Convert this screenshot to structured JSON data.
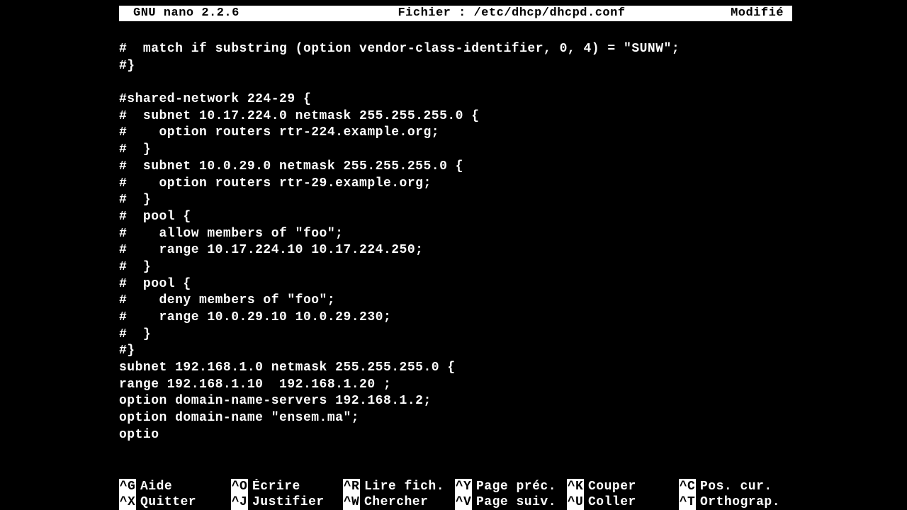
{
  "titlebar": {
    "app": "GNU nano 2.2.6",
    "file_label": "Fichier : /etc/dhcp/dhcpd.conf",
    "status": "Modifié"
  },
  "lines": [
    "#  match if substring (option vendor-class-identifier, 0, 4) = \"SUNW\";",
    "#}",
    "",
    "#shared-network 224-29 {",
    "#  subnet 10.17.224.0 netmask 255.255.255.0 {",
    "#    option routers rtr-224.example.org;",
    "#  }",
    "#  subnet 10.0.29.0 netmask 255.255.255.0 {",
    "#    option routers rtr-29.example.org;",
    "#  }",
    "#  pool {",
    "#    allow members of \"foo\";",
    "#    range 10.17.224.10 10.17.224.250;",
    "#  }",
    "#  pool {",
    "#    deny members of \"foo\";",
    "#    range 10.0.29.10 10.0.29.230;",
    "#  }",
    "#}",
    "subnet 192.168.1.0 netmask 255.255.255.0 {",
    "range 192.168.1.10  192.168.1.20 ;",
    "option domain-name-servers 192.168.1.2;",
    "option domain-name \"ensem.ma\";",
    "optio"
  ],
  "shortcuts": {
    "row1": [
      {
        "key": "^G",
        "label": "Aide"
      },
      {
        "key": "^O",
        "label": "Écrire"
      },
      {
        "key": "^R",
        "label": "Lire fich."
      },
      {
        "key": "^Y",
        "label": "Page préc."
      },
      {
        "key": "^K",
        "label": "Couper"
      },
      {
        "key": "^C",
        "label": "Pos. cur."
      }
    ],
    "row2": [
      {
        "key": "^X",
        "label": "Quitter"
      },
      {
        "key": "^J",
        "label": "Justifier"
      },
      {
        "key": "^W",
        "label": "Chercher"
      },
      {
        "key": "^V",
        "label": "Page suiv."
      },
      {
        "key": "^U",
        "label": "Coller"
      },
      {
        "key": "^T",
        "label": "Orthograp."
      }
    ]
  }
}
